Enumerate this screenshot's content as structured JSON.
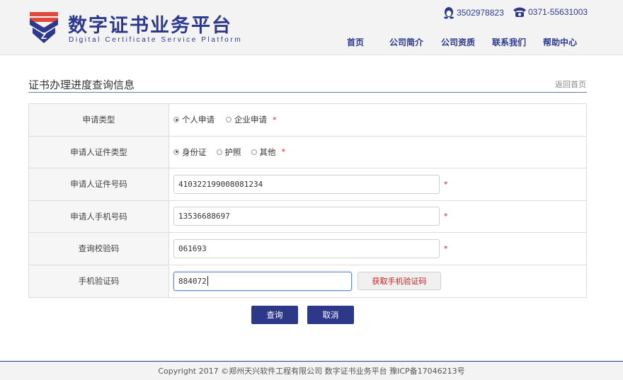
{
  "header": {
    "brand_title": "数字证书业务平台",
    "brand_subtitle": "Digital Certificate Service Platform",
    "qq": "3502978823",
    "phone": "0371-55631003",
    "nav": [
      "首页",
      "公司简介",
      "公司资质",
      "联系我们",
      "帮助中心"
    ]
  },
  "page": {
    "title": "证书办理进度查询信息",
    "back_link": "返回首页"
  },
  "form": {
    "apply_type": {
      "label": "申请类型",
      "options": [
        "个人申请",
        "企业申请"
      ],
      "selected": "个人申请"
    },
    "id_type": {
      "label": "申请人证件类型",
      "options": [
        "身份证",
        "护照",
        "其他"
      ],
      "selected": "身份证"
    },
    "id_number": {
      "label": "申请人证件号码",
      "value": "410322199008081234"
    },
    "mobile": {
      "label": "申请人手机号码",
      "value": "13536688697"
    },
    "query_code": {
      "label": "查询校验码",
      "value": "061693"
    },
    "sms_code": {
      "label": "手机验证码",
      "value": "884072",
      "button_label": "获取手机验证码"
    },
    "required_mark": "*"
  },
  "buttons": {
    "query": "查询",
    "cancel": "取消"
  },
  "footer": {
    "text": "Copyright 2017 ©郑州天兴软件工程有限公司 数字证书业务平台 豫ICP备17046213号"
  },
  "colors": {
    "brand": "#2d3a8c",
    "button": "#2e3888",
    "required": "#d92020",
    "logo_red": "#e04a3c"
  }
}
